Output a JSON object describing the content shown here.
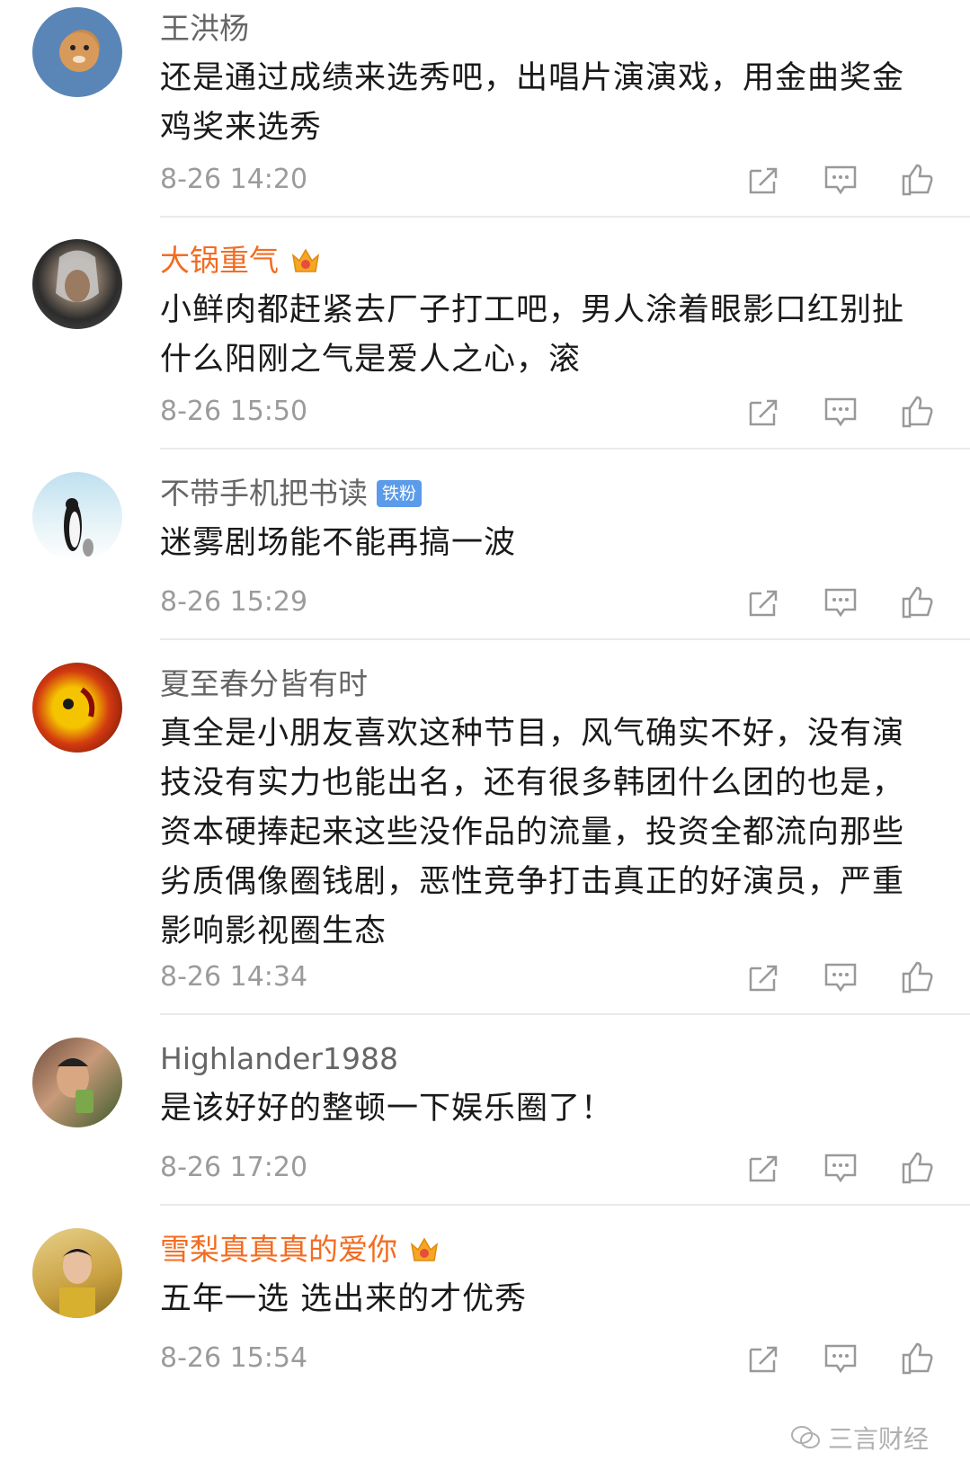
{
  "comments": [
    {
      "username": "王洪杨",
      "vip": false,
      "badge": "",
      "text": "还是通过成绩来选秀吧，出唱片演演戏，用金曲奖金鸡奖来选秀",
      "time": "8-26 14:20"
    },
    {
      "username": "大锅重气",
      "vip": true,
      "badge": "crown",
      "text": "小鲜肉都赶紧去厂子打工吧，男人涂着眼影口红别扯什么阳刚之气是爱人之心，滚",
      "time": "8-26 15:50"
    },
    {
      "username": "不带手机把书读",
      "vip": false,
      "badge": "铁粉",
      "text": "迷雾剧场能不能再搞一波",
      "time": "8-26 15:29"
    },
    {
      "username": "夏至春分皆有时",
      "vip": false,
      "badge": "",
      "text": "真全是小朋友喜欢这种节目，风气确实不好，没有演技没有实力也能出名，还有很多韩团什么团的也是，资本硬捧起来这些没作品的流量，投资全都流向那些劣质偶像圈钱剧，恶性竞争打击真正的好演员，严重影响影视圈生态",
      "time": "8-26 14:34"
    },
    {
      "username": "Highlander1988",
      "vip": false,
      "badge": "",
      "text": "是该好好的整顿一下娱乐圈了！",
      "time": "8-26 17:20"
    },
    {
      "username": "雪梨真真真的爱你",
      "vip": true,
      "badge": "crown",
      "text": "五年一选 选出来的才优秀",
      "time": "8-26 15:54"
    }
  ],
  "icons": {
    "repost": "repost-icon",
    "comment": "comment-icon",
    "like": "like-icon"
  },
  "watermark": {
    "text": "三言财经",
    "icon": "wechat-icon"
  },
  "colors": {
    "vip_name": "#f36c21",
    "name": "#666666",
    "time": "#9b9b9b",
    "fan_badge": "#5b9bea"
  }
}
